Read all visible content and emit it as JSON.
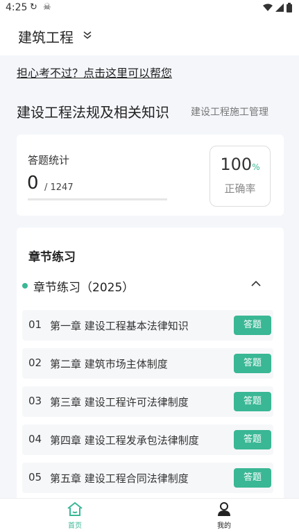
{
  "status_bar": {
    "time": "4:25",
    "icons_left": "↻ ☠"
  },
  "header": {
    "title": "建筑工程"
  },
  "help_link": "担心考不过？点击这里可以帮您",
  "subject": {
    "primary": "建设工程法规及相关知识",
    "secondary": "建设工程施工管理"
  },
  "stats": {
    "label": "答题统计",
    "answered": "0",
    "total": "/ 1247",
    "progress_fraction": 0,
    "accuracy_value": "100",
    "accuracy_unit": "%",
    "accuracy_label": "正确率"
  },
  "chapters": {
    "title": "章节练习",
    "group_label": "章节练习（2025）",
    "items": [
      {
        "num": "01",
        "name": "第一章 建设工程基本法律知识",
        "action": "答题"
      },
      {
        "num": "02",
        "name": "第二章 建筑市场主体制度",
        "action": "答题"
      },
      {
        "num": "03",
        "name": "第三章 建设工程许可法律制度",
        "action": "答题"
      },
      {
        "num": "04",
        "name": "第四章 建设工程发承包法律制度",
        "action": "答题"
      },
      {
        "num": "05",
        "name": "第五章 建设工程合同法律制度",
        "action": "答题"
      }
    ]
  },
  "bottom_nav": {
    "home": "首页",
    "mine": "我的"
  },
  "colors": {
    "accent": "#3ab795",
    "background": "#f4f6fa"
  }
}
